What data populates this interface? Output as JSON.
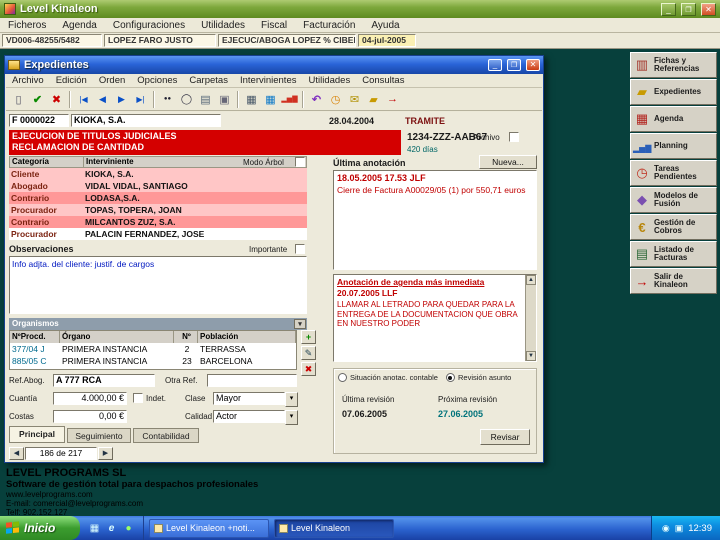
{
  "app": {
    "title": "Level Kinaleon",
    "menus": [
      "Ficheros",
      "Agenda",
      "Configuraciones",
      "Utilidades",
      "Fiscal",
      "Facturación",
      "Ayuda"
    ],
    "quickbar": {
      "ref": "VD006-48255/5482",
      "name": "LOPEZ FARO JUSTO",
      "subject": "EJECUC/ABOGA LOPEZ % CIBER",
      "date": "04-jul-2005"
    },
    "sidebar": [
      {
        "label": "Fichas y Referencias",
        "icon": "books-icon"
      },
      {
        "label": "Expedientes",
        "icon": "folder-icon"
      },
      {
        "label": "Agenda",
        "icon": "calendar-icon"
      },
      {
        "label": "Planning",
        "icon": "planning-chart-icon"
      },
      {
        "label": "Tareas Pendientes",
        "icon": "alarm-clock-icon"
      },
      {
        "label": "Modelos de Fusión",
        "icon": "merge-documents-icon"
      },
      {
        "label": "Gestión de Cobros",
        "icon": "coins-icon"
      },
      {
        "label": "Listado de Facturas",
        "icon": "invoice-list-icon"
      },
      {
        "label": "Salir de Kinaleon",
        "icon": "exit-icon"
      }
    ],
    "footer": {
      "company": "LEVEL PROGRAMS SL",
      "tagline": "Software de gestión total para despachos profesionales",
      "web": "www.levelprograms.com",
      "email": "E-mail: comercial@levelprograms.com",
      "phone": "Telf: 902.152.127"
    }
  },
  "taskbar": {
    "start_label": "Inicio",
    "tasks": [
      "Level Kinaleon +noti...",
      "Level Kinaleon"
    ],
    "clock": "12:39"
  },
  "exp": {
    "title": "Expedientes",
    "menus": [
      "Archivo",
      "Edición",
      "Orden",
      "Opciones",
      "Carpetas",
      "Intervinientes",
      "Utilidades",
      "Consultas"
    ],
    "toolbar_icons": [
      "new-record",
      "save",
      "delete",
      "first-record",
      "previous-record",
      "next-record",
      "last-record",
      "search-binoculars",
      "zoom",
      "preview",
      "print",
      "calculator",
      "table",
      "chart",
      "undo",
      "history",
      "mail",
      "folders",
      "exit"
    ],
    "record": {
      "code": "F 0000022",
      "client": "KIOKA, S.A.",
      "date": "28.04.2004",
      "status": "TRAMITE",
      "matter_line1": "EJECUCION DE TITULOS JUDICIALES",
      "matter_line2": "RECLAMACION DE CANTIDAD",
      "reference": "1234-ZZZ-AAB67",
      "days": "420 días",
      "archive_label": "Archivo"
    },
    "parties": {
      "col_categoria": "Categoría",
      "col_interviniente": "Interviniente",
      "tree_mode_label": "Modo Árbol",
      "rows": [
        {
          "cat": "Cliente",
          "name": "KIOKA, S.A."
        },
        {
          "cat": "Abogado",
          "name": "VIDAL VIDAL, SANTIAGO"
        },
        {
          "cat": "Contrario",
          "name": "LODASA,S.A."
        },
        {
          "cat": "Procurador",
          "name": "TOPAS, TOPERA, JOAN"
        },
        {
          "cat": "Contrario",
          "name": "MILCANTOS ZUZ, S.A."
        },
        {
          "cat": "Procurador",
          "name": "PALACIN FERNANDEZ, JOSE"
        }
      ]
    },
    "obs": {
      "label": "Observaciones",
      "important_label": "Importante",
      "text": "Info adjta. del cliente: justif. de cargos"
    },
    "proc": {
      "section_label": "Organismos",
      "headers": [
        "NºProcd.",
        "Órgano",
        "Nº",
        "Población"
      ],
      "rows": [
        [
          "377/04 J",
          "PRIMERA INSTANCIA",
          "2",
          "TERRASSA"
        ],
        [
          "885/05 C",
          "PRIMERA INSTANCIA",
          "23",
          "BARCELONA"
        ]
      ]
    },
    "fields": {
      "ref_abog_label": "Ref.Abog.",
      "ref_abog_value": "A 777 RCA",
      "otra_ref_label": "Otra Ref.",
      "otra_ref_value": "",
      "cuantia_label": "Cuantía",
      "cuantia_value": "4.000,00 €",
      "indet_label": "Indet.",
      "clase_label": "Clase",
      "clase_value": "Mayor",
      "costas_label": "Costas",
      "costas_value": "0,00 €",
      "calidad_label": "Calidad",
      "calidad_value": "Actor"
    },
    "annotation": {
      "label": "Última anotación",
      "new_button": "Nueva...",
      "datetime": "18.05.2005 17.53 JLF",
      "text": "Cierre de Factura A00029/05 (1) por 550,71 euros",
      "agenda_label": "Anotación de agenda más inmediata",
      "agenda_date": "20.07.2005  LLF",
      "agenda_text": "LLAMAR AL LETRADO PARA QUEDAR PARA LA ENTREGA DE LA DOCUMENTACION QUE OBRA EN NUESTRO PODER"
    },
    "revision": {
      "option1": "Situación anotac. contable",
      "option2": "Revisión asunto",
      "last_label": "Última revisión",
      "last_value": "07.06.2005",
      "next_label": "Próxima revisión",
      "next_value": "27.06.2005",
      "button": "Revisar"
    },
    "tabs": [
      "Principal",
      "Seguimiento",
      "Contabilidad"
    ],
    "nav_position": "186 de 217"
  }
}
